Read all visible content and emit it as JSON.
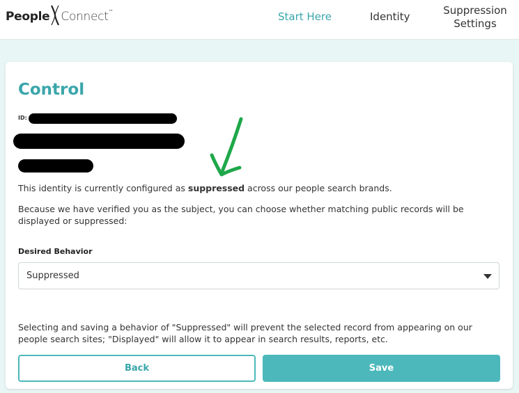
{
  "header": {
    "logo": {
      "people": "People",
      "connect": "Connect",
      "tm": "™"
    },
    "nav": [
      {
        "label": "Start Here",
        "active": true
      },
      {
        "label": "Identity",
        "active": false
      },
      {
        "label": "Suppression Settings",
        "active": false
      }
    ]
  },
  "card": {
    "title": "Control",
    "id_label": "ID:",
    "status": {
      "prefix": "This identity is currently configured as ",
      "value": "suppressed",
      "suffix": " across our people search brands."
    },
    "explanation": "Because we have verified you as the subject, you can choose whether matching public records will be displayed or suppressed:",
    "desired_behavior": {
      "label": "Desired Behavior",
      "selected": "Suppressed"
    },
    "note": "Selecting and saving a behavior of \"Suppressed\" will prevent the selected record from appearing on our people search sites; \"Displayed\" will allow it to appear in search results, reports, etc.",
    "buttons": {
      "back": "Back",
      "save": "Save"
    }
  },
  "colors": {
    "accent": "#3aa6ab",
    "button_fill": "#4cb8bb",
    "annotation_arrow": "#1fa84a",
    "redaction": "#000000"
  },
  "icons": [
    "people-connect-logo-x-icon",
    "dropdown-caret-icon",
    "annotation-arrow-icon"
  ]
}
